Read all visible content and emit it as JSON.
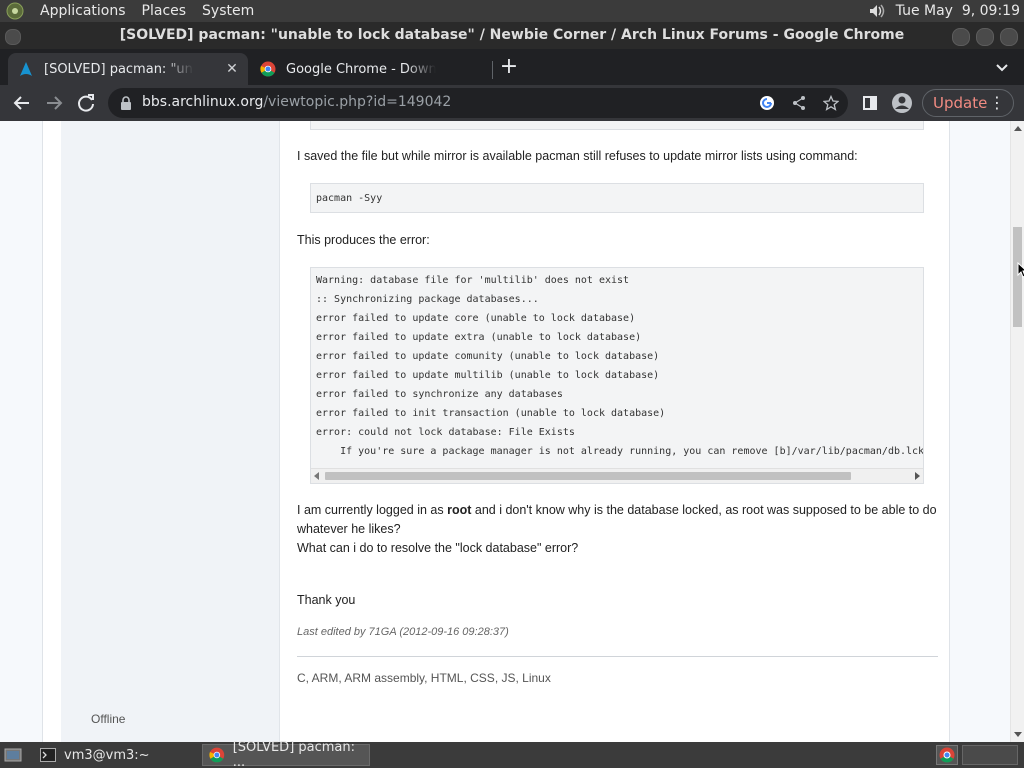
{
  "top_panel": {
    "menus": [
      "Applications",
      "Places",
      "System"
    ],
    "clock": "Tue May  9, 09:19"
  },
  "window": {
    "title": "[SOLVED] pacman: \"unable to lock database\" / Newbie Corner / Arch Linux Forums - Google Chrome"
  },
  "tabs": [
    {
      "label": "[SOLVED] pacman: \"unable to lock database\"",
      "favicon": "arch-logo-icon",
      "active": true
    },
    {
      "label": "Google Chrome - Download the fast, secure browser",
      "favicon": "chrome-icon",
      "active": false
    }
  ],
  "toolbar": {
    "url_host": "bbs.archlinux.org",
    "url_path": "/viewtopic.php?id=149042",
    "update_label": "Update"
  },
  "post": {
    "para_1": "I saved the file but while mirror is available pacman still refuses to update mirror lists using command:",
    "code_1": "pacman -Syy",
    "para_2": "This produces the error:",
    "code_2": [
      "Warning: database file for 'multilib' does not exist",
      ":: Synchronizing package databases...",
      "error failed to update core (unable to lock database)",
      "error failed to update extra (unable to lock database)",
      "error failed to update comunity (unable to lock database)",
      "error failed to update multilib (unable to lock database)",
      "error failed to synchronize any databases",
      "error failed to init transaction (unable to lock database)",
      "error: could not lock database: File Exists",
      "    If you're sure a package manager is not already running, you can remove [b]/var/lib/pacman/db.lck[/b]"
    ],
    "para_3_pre": "I am currently logged in as ",
    "para_3_bold": "root",
    "para_3_post": " and i don't know why is the database locked, as root was supposed to be able to do whatever he likes?",
    "para_4": "What can i do to resolve the \"lock database\" error?",
    "para_5": "Thank you",
    "edited": "Last edited by 71GA (2012-09-16 09:28:37)",
    "signature": "C, ARM, ARM assembly, HTML, CSS, JS, Linux",
    "status": "Offline"
  },
  "taskbar": {
    "items": [
      {
        "label": "vm3@vm3:~",
        "icon": "terminal-icon"
      },
      {
        "label": "[SOLVED] pacman: ...",
        "icon": "chrome-icon"
      }
    ]
  }
}
